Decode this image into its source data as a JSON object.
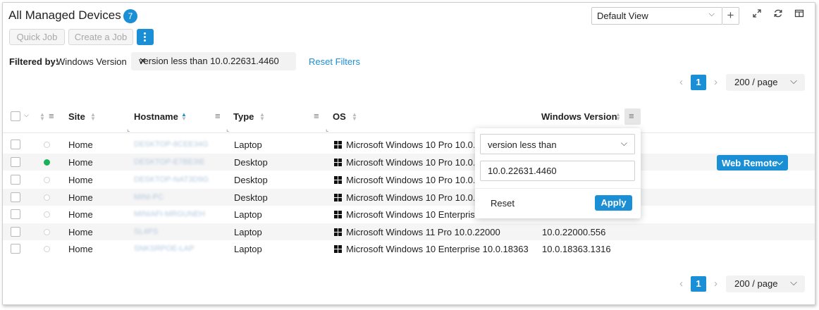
{
  "header": {
    "title": "All Managed Devices",
    "device_count": "7",
    "quick_job_label": "Quick Job",
    "create_job_label": "Create a Job",
    "view_select_value": "Default View"
  },
  "filters": {
    "filtered_by_label": "Filtered by:",
    "field_name": "Windows Version",
    "chip_text": "version less than 10.0.22631.4460",
    "reset_label": "Reset Filters"
  },
  "pagination": {
    "current_page": "1",
    "per_page": "200 / page"
  },
  "table": {
    "columns": {
      "site": "Site",
      "hostname": "Hostname",
      "type": "Type",
      "os": "OS",
      "windows_version": "Windows Version"
    },
    "rows": [
      {
        "online": false,
        "site": "Home",
        "hostname": "DESKTOP-8CEE34G",
        "type": "Laptop",
        "os": "Microsoft Windows 10 Pro 10.0.1",
        "version": ""
      },
      {
        "online": true,
        "site": "Home",
        "hostname": "DESKTOP-E7BE3IE",
        "type": "Desktop",
        "os": "Microsoft Windows 10 Pro 10.0.1",
        "version": ""
      },
      {
        "online": false,
        "site": "Home",
        "hostname": "DESKTOP-NAT3D9G",
        "type": "Desktop",
        "os": "Microsoft Windows 10 Pro 10.0.1",
        "version": ""
      },
      {
        "online": false,
        "site": "Home",
        "hostname": "MINI-PC",
        "type": "Desktop",
        "os": "Microsoft Windows 10 Pro 10.0.1",
        "version": ""
      },
      {
        "online": false,
        "site": "Home",
        "hostname": "MINIAFI-MRGUNEH",
        "type": "Laptop",
        "os": "Microsoft Windows 10 Enterprise",
        "version": ""
      },
      {
        "online": false,
        "site": "Home",
        "hostname": "SL4PS",
        "type": "Laptop",
        "os": "Microsoft Windows 11 Pro 10.0.22000",
        "version": "10.0.22000.556"
      },
      {
        "online": false,
        "site": "Home",
        "hostname": "SNKSRPOE-LAP",
        "type": "Laptop",
        "os": "Microsoft Windows 10 Enterprise 10.0.18363",
        "version": "10.0.18363.1316"
      }
    ],
    "row_action_label": "Web Remote"
  },
  "filter_popover": {
    "operator": "version less than",
    "value": "10.0.22631.4460",
    "reset_label": "Reset",
    "apply_label": "Apply"
  },
  "colors": {
    "accent": "#1a8fd6",
    "online": "#19b15a"
  }
}
